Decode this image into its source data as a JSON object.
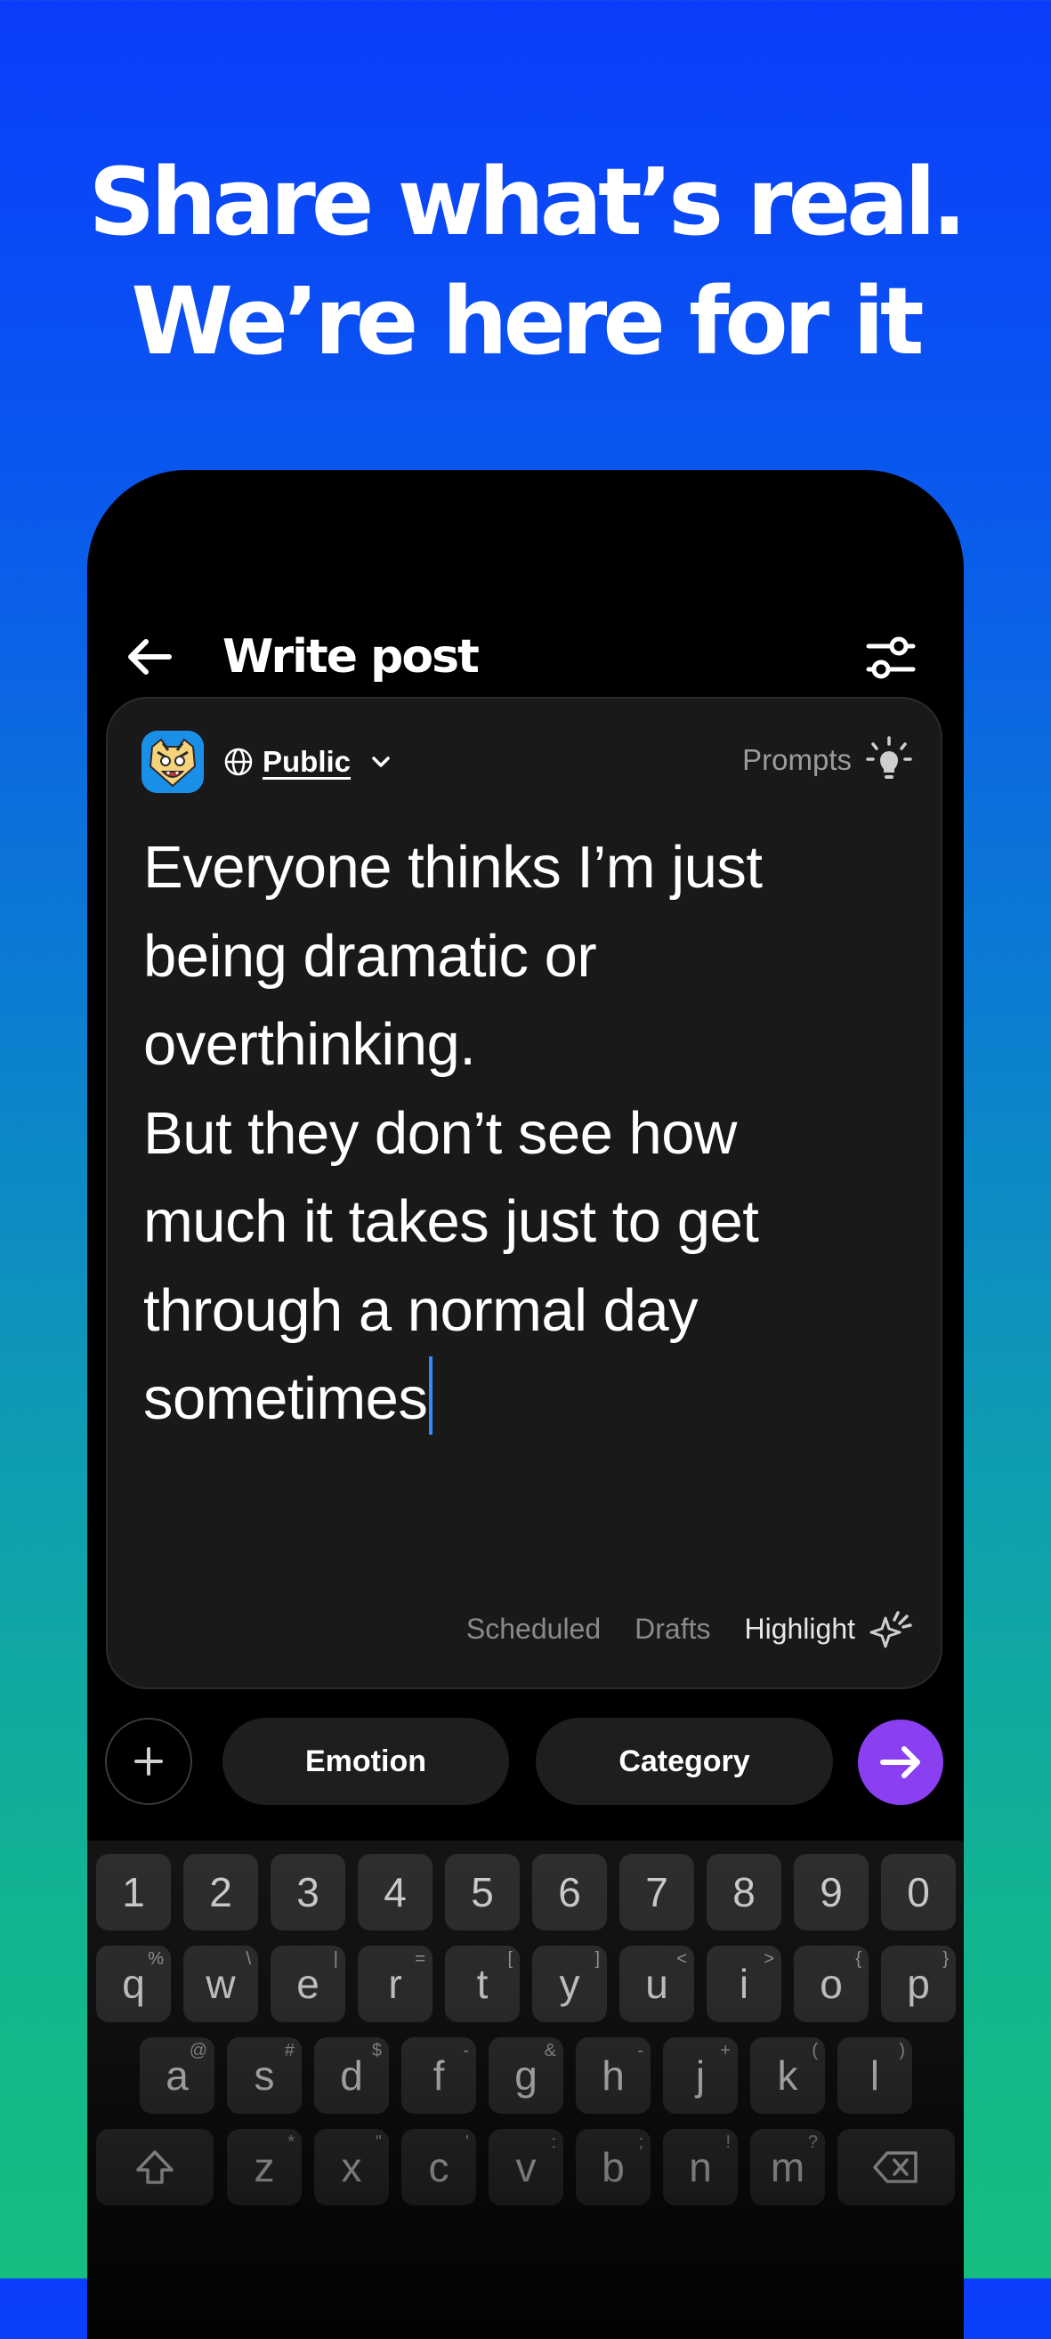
{
  "headline": {
    "line1": "Share what’s real.",
    "line2": "We’re here for it"
  },
  "header": {
    "title": "Write post"
  },
  "composer": {
    "visibility": "Public",
    "prompts_label": "Prompts",
    "text": "Everyone thinks I’m just\nbeing dramatic or\noverthinking.\nBut they don’t see how\nmuch it takes just to get\nthrough a normal day\nsometimes",
    "footer": {
      "scheduled": "Scheduled",
      "drafts": "Drafts",
      "highlight": "Highlight"
    }
  },
  "actions": {
    "emotion": "Emotion",
    "category": "Category"
  },
  "keyboard": {
    "rows": [
      [
        {
          "k": "1"
        },
        {
          "k": "2"
        },
        {
          "k": "3"
        },
        {
          "k": "4"
        },
        {
          "k": "5"
        },
        {
          "k": "6"
        },
        {
          "k": "7"
        },
        {
          "k": "8"
        },
        {
          "k": "9"
        },
        {
          "k": "0"
        }
      ],
      [
        {
          "k": "q",
          "s": "%"
        },
        {
          "k": "w",
          "s": "\\"
        },
        {
          "k": "e",
          "s": "|"
        },
        {
          "k": "r",
          "s": "="
        },
        {
          "k": "t",
          "s": "["
        },
        {
          "k": "y",
          "s": "]"
        },
        {
          "k": "u",
          "s": "<"
        },
        {
          "k": "i",
          "s": ">"
        },
        {
          "k": "o",
          "s": "{"
        },
        {
          "k": "p",
          "s": "}"
        }
      ],
      [
        {
          "k": "a",
          "s": "@"
        },
        {
          "k": "s",
          "s": "#"
        },
        {
          "k": "d",
          "s": "$"
        },
        {
          "k": "f",
          "s": "-"
        },
        {
          "k": "g",
          "s": "&"
        },
        {
          "k": "h",
          "s": "-"
        },
        {
          "k": "j",
          "s": "+"
        },
        {
          "k": "k",
          "s": "("
        },
        {
          "k": "l",
          "s": ")"
        }
      ],
      [
        {
          "k": "z",
          "s": "*"
        },
        {
          "k": "x",
          "s": "\""
        },
        {
          "k": "c",
          "s": "'"
        },
        {
          "k": "v",
          "s": ":"
        },
        {
          "k": "b",
          "s": ";"
        },
        {
          "k": "n",
          "s": "!"
        },
        {
          "k": "m",
          "s": "?"
        }
      ]
    ]
  },
  "colors": {
    "accent_send": "#8a3ff1",
    "cursor": "#2f8cff",
    "bg_top": "#0a3dfb",
    "bg_bottom": "#16bd80"
  }
}
